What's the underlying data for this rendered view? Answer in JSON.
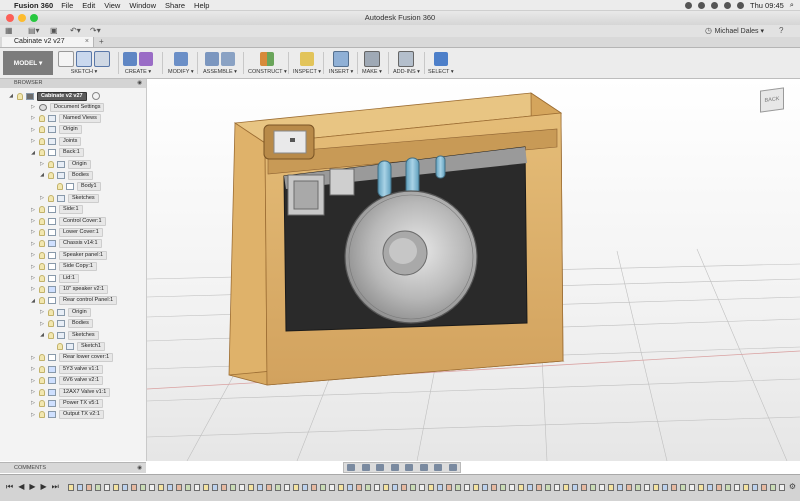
{
  "menubar": {
    "app_name": "Fusion 360",
    "items": [
      "File",
      "Edit",
      "View",
      "Window",
      "Share",
      "Help"
    ],
    "clock": "Thu 09:45"
  },
  "window": {
    "title": "Autodesk Fusion 360"
  },
  "user": {
    "name": "Michael Dales ▾"
  },
  "document_tab": {
    "name": "Cabinate v2 v27",
    "close": "×",
    "add": "+"
  },
  "toolbar": {
    "workspace": "MODEL ▾",
    "groups": [
      "SKETCH ▾",
      "CREATE ▾",
      "MODIFY ▾",
      "ASSEMBLE ▾",
      "CONSTRUCT ▾",
      "INSPECT ▾",
      "INSERT ▾",
      "MAKE ▾",
      "ADD-INS ▾",
      "SELECT ▾"
    ]
  },
  "browser": {
    "title": "BROWSER",
    "root": "Cabinate v2 v27",
    "items": [
      {
        "label": "Document Settings",
        "level": 1,
        "icon": "gear-icon"
      },
      {
        "label": "Named Views",
        "level": 1,
        "icon": "folder-icon"
      },
      {
        "label": "Origin",
        "level": 1,
        "icon": "folder-icon"
      },
      {
        "label": "Joints",
        "level": 1,
        "icon": "folder-icon"
      },
      {
        "label": "Back:1",
        "level": 1,
        "icon": "component-icon",
        "expanded": true
      },
      {
        "label": "Origin",
        "level": 2,
        "icon": "folder-icon"
      },
      {
        "label": "Bodies",
        "level": 2,
        "icon": "folder-icon",
        "expanded": true
      },
      {
        "label": "Body1",
        "level": 3,
        "icon": "body-icon"
      },
      {
        "label": "Sketches",
        "level": 2,
        "icon": "folder-icon"
      },
      {
        "label": "Side:1",
        "level": 1,
        "icon": "component-icon"
      },
      {
        "label": "Control Cover:1",
        "level": 1,
        "icon": "component-icon"
      },
      {
        "label": "Lower Cover:1",
        "level": 1,
        "icon": "component-icon"
      },
      {
        "label": "Chassis v14:1",
        "level": 1,
        "icon": "link-icon"
      },
      {
        "label": "Speaker panel:1",
        "level": 1,
        "icon": "component-icon"
      },
      {
        "label": "Side Copy:1",
        "level": 1,
        "icon": "component-icon"
      },
      {
        "label": "Lid:1",
        "level": 1,
        "icon": "component-icon"
      },
      {
        "label": "10\" speaker v2:1",
        "level": 1,
        "icon": "link-icon"
      },
      {
        "label": "Rear control Panel:1",
        "level": 1,
        "icon": "component-icon",
        "expanded": true
      },
      {
        "label": "Origin",
        "level": 2,
        "icon": "folder-icon"
      },
      {
        "label": "Bodies",
        "level": 2,
        "icon": "folder-icon"
      },
      {
        "label": "Sketches",
        "level": 2,
        "icon": "folder-icon",
        "expanded": true
      },
      {
        "label": "Sketch1",
        "level": 3,
        "icon": "sketch-icon"
      },
      {
        "label": "Rear lower cover:1",
        "level": 1,
        "icon": "component-icon"
      },
      {
        "label": "5Y3 valve v1:1",
        "level": 1,
        "icon": "link-icon"
      },
      {
        "label": "6V6 valve v2:1",
        "level": 1,
        "icon": "link-icon"
      },
      {
        "label": "12AX7 Valve v1:1",
        "level": 1,
        "icon": "link-icon"
      },
      {
        "label": "Power TX v5:1",
        "level": 1,
        "icon": "link-icon"
      },
      {
        "label": "Output TX v2:1",
        "level": 1,
        "icon": "link-icon"
      }
    ]
  },
  "comments": {
    "title": "COMMENTS"
  },
  "viewcube": {
    "face": "BACK"
  },
  "colors": {
    "wood_light": "#e0b56e",
    "wood_dark": "#b9843f",
    "interior": "#2b2b2b",
    "speaker": "#bdbdbd",
    "valve_glass": "#7fb6cf",
    "toolbar_bg": "#ececec",
    "selected": "#5a5a5a"
  }
}
